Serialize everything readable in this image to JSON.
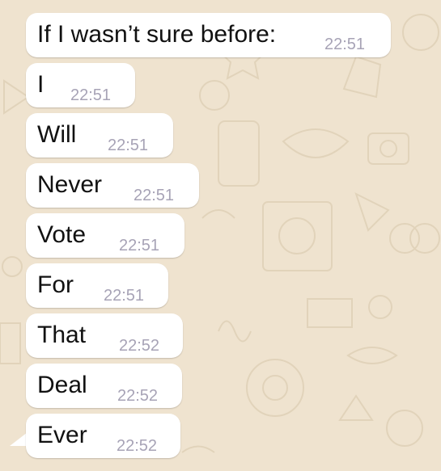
{
  "chat": {
    "messages": [
      {
        "text": "If I wasn’t sure before:",
        "time": "22:51"
      },
      {
        "text": "I",
        "time": "22:51"
      },
      {
        "text": "Will",
        "time": "22:51"
      },
      {
        "text": "Never",
        "time": "22:51"
      },
      {
        "text": "Vote",
        "time": "22:51"
      },
      {
        "text": "For",
        "time": "22:51"
      },
      {
        "text": "That",
        "time": "22:52"
      },
      {
        "text": "Deal",
        "time": "22:52"
      },
      {
        "text": "Ever",
        "time": "22:52"
      }
    ]
  },
  "colors": {
    "background": "#efe3cf",
    "bubble": "#ffffff",
    "timestamp": "#a7a3b6",
    "text": "#111111"
  }
}
